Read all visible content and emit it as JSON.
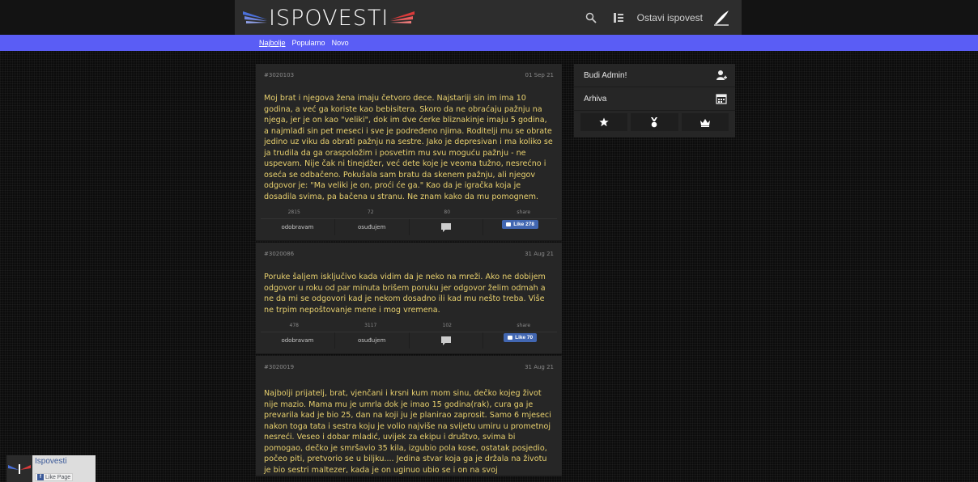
{
  "header": {
    "logo_text": "ISPOVESTI",
    "submit_label": "Ostavi ispovest"
  },
  "nav": {
    "items": [
      "Najbolje",
      "Popularno",
      "Novo"
    ],
    "active": "Najbolje"
  },
  "posts": [
    {
      "id": "#3020103",
      "date": "01 Sep 21",
      "text": "Moj brat i njegova žena imaju četvoro dece. Najstariji sin im ima 10 godina, a već ga koriste kao bebisitera. Skoro da ne obraćaju pažnju na njega, jer je on kao \"veliki\", dok im dve ćerke bliznakinje imaju 5 godina, a najmlađi sin pet meseci i sve je podređeno njima. Roditelji mu se obrate jedino uz viku da obrati pažnju na sestre. Jako je depresivan i ma koliko se ja trudila da ga oraspoložim i posvetim mu svu moguću pažnju - ne uspevam. Nije čak ni tinejdžer, već dete koje je veoma tužno, nesrećno i oseća se odbačeno. Pokušala sam bratu da skenem pažnju, ali njegov odgovor je: \"Ma veliki je on, proći će ga.\" Kao da je igračka koja je dosadila svima, pa bačena u stranu. Ne znam kako da mu pomognem.",
      "approve_count": "2815",
      "condemn_count": "72",
      "comment_count": "80",
      "share_label": "share",
      "approve_label": "odobravam",
      "condemn_label": "osuđujem",
      "like_label": "Like 278"
    },
    {
      "id": "#3020086",
      "date": "31 Aug 21",
      "text": "Poruke šaljem isključivo kada vidim da je neko na mreži. Ako ne dobijem odgovor u roku od par minuta brišem poruku jer odgovor želim odmah a ne da mi se odgovori kad je nekom dosadno ili kad mu nešto treba. Više ne trpim nepoštovanje mene i mog vremena.",
      "approve_count": "478",
      "condemn_count": "3117",
      "comment_count": "102",
      "share_label": "share",
      "approve_label": "odobravam",
      "condemn_label": "osuđujem",
      "like_label": "Like 70"
    },
    {
      "id": "#3020019",
      "date": "31 Aug 21",
      "text": "Najbolji prijatelj, brat, vjenčani i krsni kum mom sinu, dečko kojeg život nije mazio. Mama mu je umrla dok je imao 15 godina(rak), cura ga je prevarila kad je bio 25, dan na koji ju je planirao zaprosit. Samo 6 mjeseci nakon toga tata i sestra koju je volio najviše na svijetu umiru u prometnoj nesreći. Veseo i dobar mladić, uvijek za ekipu i društvo, svima bi pomogao, dečko je smršavio 35 kila, izgubio pola kose, ostatak posjedio, počeo piti, pretvorio se u biljku.... Jedina stvar koja ga je držala na životu je bio sestri maltezer, kada je on uginuo ubio se i on na svoj"
    }
  ],
  "sidebar": {
    "budi_admin": "Budi Admin!",
    "arhiva": "Arhiva"
  },
  "fb_widget": {
    "name": "Ispovesti",
    "like_page": "Like Page"
  },
  "colors": {
    "accent": "#5a5df5",
    "post_text": "#e8d06e",
    "fb_blue": "#4267b2"
  }
}
